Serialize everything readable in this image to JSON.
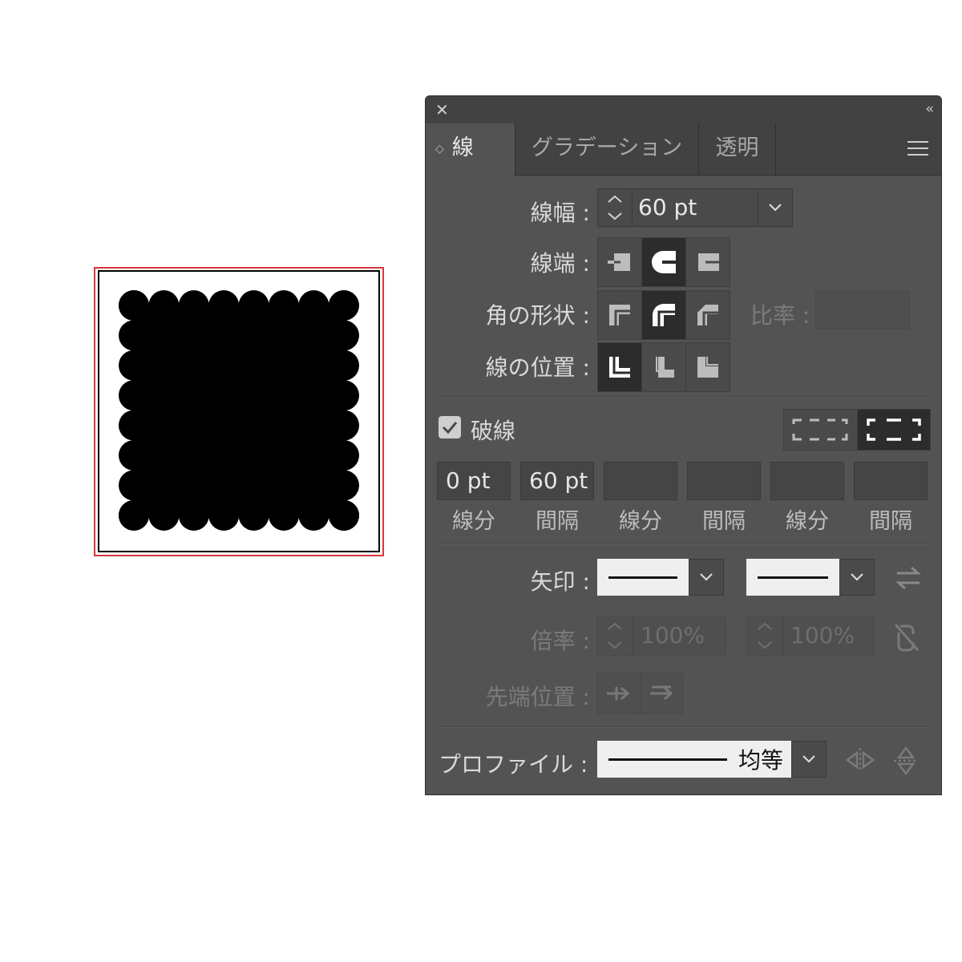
{
  "artwork": {
    "description_colors": {
      "selection": "#d9363e",
      "shape": "#000000"
    }
  },
  "panel": {
    "tabs": [
      {
        "label": "線",
        "active": true
      },
      {
        "label": "グラデーション",
        "active": false
      },
      {
        "label": "透明",
        "active": false
      }
    ],
    "weight": {
      "label": "線幅 :",
      "value": "60 pt"
    },
    "cap": {
      "label": "線端 :",
      "selected_index": 1
    },
    "corner": {
      "label": "角の形状 :",
      "selected_index": 1,
      "limit_label": "比率 :",
      "limit_value": ""
    },
    "align": {
      "label": "線の位置 :",
      "selected_index": 0
    },
    "dashed": {
      "label": "破線",
      "checked": true,
      "fields": [
        {
          "value": "0 pt",
          "label": "線分"
        },
        {
          "value": "60 pt",
          "label": "間隔"
        },
        {
          "value": "",
          "label": "線分"
        },
        {
          "value": "",
          "label": "間隔"
        },
        {
          "value": "",
          "label": "線分"
        },
        {
          "value": "",
          "label": "間隔"
        }
      ]
    },
    "arrowheads": {
      "label": "矢印 :"
    },
    "scale": {
      "label": "倍率 :",
      "start": "100%",
      "end": "100%"
    },
    "align_arrows": {
      "label": "先端位置 :"
    },
    "profile": {
      "label": "プロファイル :",
      "value": "均等"
    }
  }
}
